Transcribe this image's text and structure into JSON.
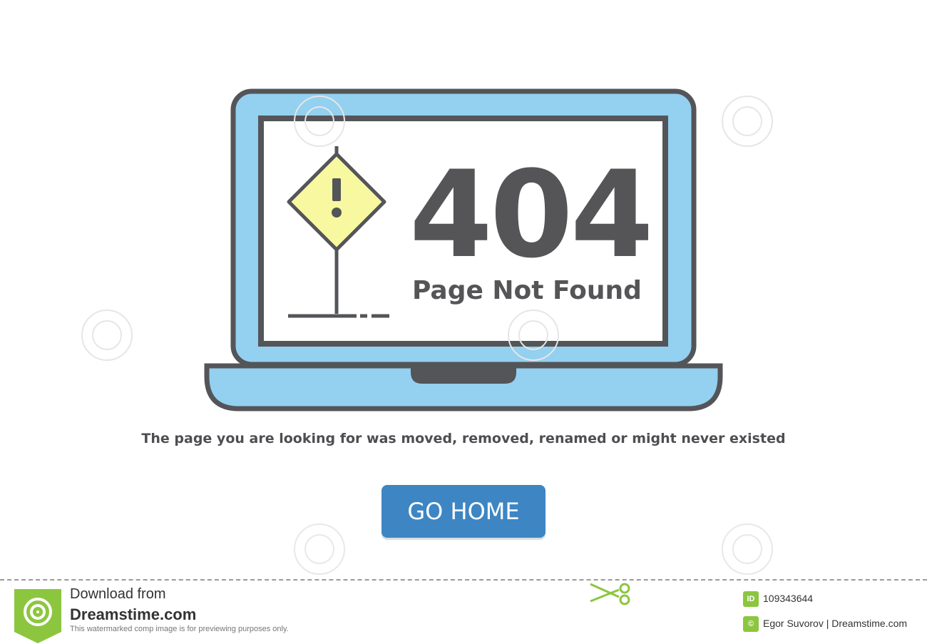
{
  "error": {
    "code": "404",
    "title": "Page Not Found",
    "message": "The page you are looking for was moved, removed, renamed or might never existed"
  },
  "actions": {
    "home_label": "GO HOME"
  },
  "illustration": {
    "laptop_screen_color": "#94d0ef",
    "laptop_outline_color": "#535558",
    "sign_color": "#f8f8a0",
    "sign_symbol": "!"
  },
  "footer": {
    "download_label": "Download from",
    "site_name": "Dreamstime.com",
    "note": "This watermarked comp image is for previewing purposes only.",
    "id_badge": "ID",
    "image_id": "109343644",
    "copyright_badge": "©",
    "credit": "Egor Suvorov | Dreamstime.com"
  },
  "colors": {
    "button": "#3d86c3",
    "text": "#555558",
    "brand_green": "#8cc63f"
  }
}
